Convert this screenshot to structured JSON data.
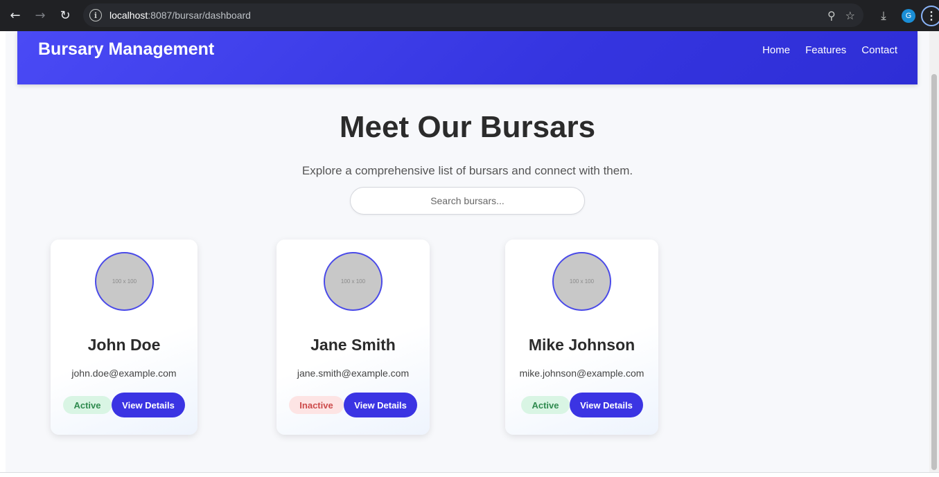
{
  "browser": {
    "url_host": "localhost",
    "url_path": ":8087/bursar/dashboard",
    "profile_initial": "G",
    "icons": [
      "back-icon",
      "forward-icon",
      "reload-icon",
      "info-icon",
      "zoom-icon",
      "star-icon",
      "download-icon",
      "menu-icon"
    ]
  },
  "header": {
    "brand": "Bursary Management",
    "nav": [
      {
        "label": "Home"
      },
      {
        "label": "Features"
      },
      {
        "label": "Contact"
      }
    ],
    "color": "#3b3bea"
  },
  "hero": {
    "title": "Meet Our Bursars",
    "subtitle": "Explore a comprehensive list of bursars and connect with them.",
    "search_placeholder": "Search bursars..."
  },
  "bursars": [
    {
      "name": "John Doe",
      "email": "john.doe@example.com",
      "status": "Active",
      "avatar_text": "100 x 100",
      "button": "View Details"
    },
    {
      "name": "Jane Smith",
      "email": "jane.smith@example.com",
      "status": "Inactive",
      "avatar_text": "100 x 100",
      "button": "View Details"
    },
    {
      "name": "Mike Johnson",
      "email": "mike.johnson@example.com",
      "status": "Active",
      "avatar_text": "100 x 100",
      "button": "View Details"
    }
  ],
  "colors": {
    "primary": "#3b34e3",
    "active_bg": "#d9f5e4",
    "active_text": "#2e8a4e",
    "inactive_bg": "#fde4e4",
    "inactive_text": "#cc4a4a"
  }
}
